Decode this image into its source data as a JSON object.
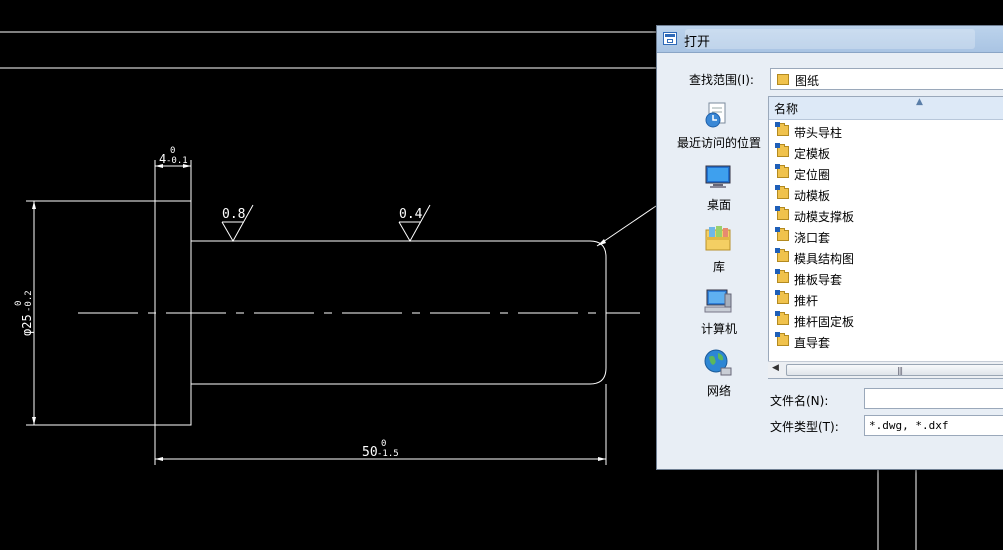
{
  "drawing": {
    "dim_width_top": "4",
    "dim_width_tol_upper": "0",
    "dim_width_tol_lower": "-0.1",
    "roughness_left": "0.8",
    "roughness_right": "0.4",
    "dim_dia": "φ25",
    "dim_dia_tol_upper": "0",
    "dim_dia_tol_lower": "-0.2",
    "dim_length": "50",
    "dim_length_tol_upper": "0",
    "dim_length_tol_lower": "-1.5"
  },
  "dialog": {
    "title": "打开",
    "look_in_label": "查找范围(I):",
    "look_in_value": "图纸",
    "places": [
      {
        "label": "最近访问的位置",
        "icon": "recent-places-icon"
      },
      {
        "label": "桌面",
        "icon": "desktop-icon"
      },
      {
        "label": "库",
        "icon": "libraries-icon"
      },
      {
        "label": "计算机",
        "icon": "computer-icon"
      },
      {
        "label": "网络",
        "icon": "network-icon"
      }
    ],
    "column_name": "名称",
    "files": [
      "带头导柱",
      "定模板",
      "定位圈",
      "动模板",
      "动模支撑板",
      "浇口套",
      "模具结构图",
      "推板导套",
      "推杆",
      "推杆固定板",
      "直导套"
    ],
    "filename_label": "文件名(N):",
    "filename_value": "",
    "filetype_label": "文件类型(T):",
    "filetype_value": "*.dwg, *.dxf"
  },
  "colors": {
    "cad_background": "#000000",
    "cad_lines": "#ffffff",
    "dialog_bg": "#e8eef5",
    "titlebar": "#bcd3ec"
  }
}
